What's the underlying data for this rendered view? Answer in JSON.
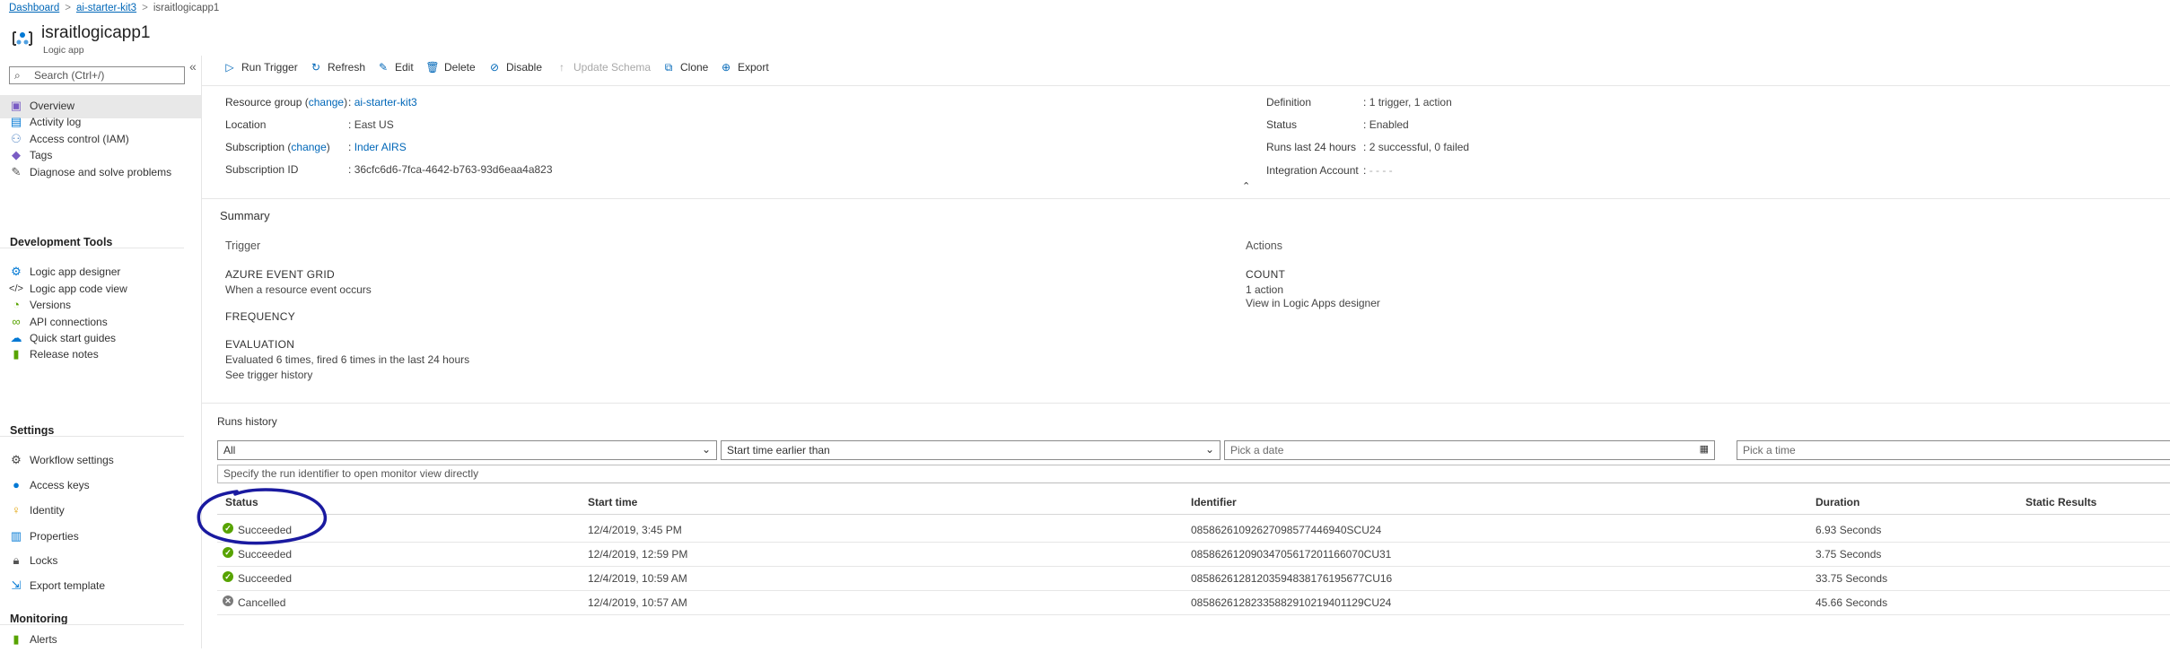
{
  "breadcrumb": [
    {
      "label": "Dashboard",
      "link": true
    },
    {
      "label": "ai-starter-kit3",
      "link": true
    },
    {
      "label": "israitlogicapp1",
      "link": false
    }
  ],
  "header": {
    "title": "israitlogicapp1",
    "subtitle": "Logic app"
  },
  "search": {
    "placeholder": "Search (Ctrl+/)"
  },
  "sidebar": {
    "collapse_glyph": "«",
    "items_top": [
      {
        "label": "Overview",
        "icon": "overview-icon"
      },
      {
        "label": "Activity log",
        "icon": "activity-log-icon"
      },
      {
        "label": "Access control (IAM)",
        "icon": "people-icon"
      },
      {
        "label": "Tags",
        "icon": "tag-icon"
      },
      {
        "label": "Diagnose and solve problems",
        "icon": "wrench-icon"
      }
    ],
    "section_dev": "Development Tools",
    "items_dev": [
      {
        "label": "Logic app designer",
        "icon": "designer-icon"
      },
      {
        "label": "Logic app code view",
        "icon": "code-icon"
      },
      {
        "label": "Versions",
        "icon": "versions-icon"
      },
      {
        "label": "API connections",
        "icon": "link-icon"
      },
      {
        "label": "Quick start guides",
        "icon": "cloud-icon"
      },
      {
        "label": "Release notes",
        "icon": "bookmark-icon"
      }
    ],
    "section_settings": "Settings",
    "items_settings": [
      {
        "label": "Workflow settings",
        "icon": "gear-icon"
      },
      {
        "label": "Access keys",
        "icon": "key-icon"
      },
      {
        "label": "Identity",
        "icon": "identity-icon"
      },
      {
        "label": "Properties",
        "icon": "properties-icon"
      },
      {
        "label": "Locks",
        "icon": "lock-icon"
      },
      {
        "label": "Export template",
        "icon": "export-template-icon"
      }
    ],
    "section_monitoring": "Monitoring",
    "items_monitoring": [
      {
        "label": "Alerts",
        "icon": "alerts-icon"
      }
    ]
  },
  "toolbar": {
    "run_trigger": "Run Trigger",
    "refresh": "Refresh",
    "edit": "Edit",
    "delete": "Delete",
    "disable": "Disable",
    "update_schema": "Update Schema",
    "clone": "Clone",
    "export": "Export"
  },
  "essentials": {
    "resource_group_label": "Resource group",
    "change": "change",
    "resource_group_value": "ai-starter-kit3",
    "location_label": "Location",
    "location_value": "East US",
    "subscription_label": "Subscription",
    "subscription_value": "Inder AIRS",
    "subscription_id_label": "Subscription ID",
    "subscription_id_value": "36cfc6d6-7fca-4642-b763-93d6eaa4a823",
    "definition_label": "Definition",
    "definition_value": "1 trigger, 1 action",
    "status_label": "Status",
    "status_value": "Enabled",
    "runs_label": "Runs last 24 hours",
    "runs_value": "2 successful, 0 failed",
    "integration_label": "Integration Account",
    "integration_value": "- - - -",
    "collapse_glyph": "⌃"
  },
  "summary": {
    "title": "Summary",
    "trigger_title": "Trigger",
    "trigger_name": "AZURE EVENT GRID",
    "trigger_desc": "When a resource event occurs",
    "frequency_title": "FREQUENCY",
    "evaluation_title": "EVALUATION",
    "evaluation_desc": "Evaluated 6 times, fired 6 times in the last 24 hours",
    "trigger_history_link": "See trigger history",
    "actions_title": "Actions",
    "actions_count_label": "COUNT",
    "actions_count": "1 action",
    "designer_link": "View in Logic Apps designer"
  },
  "runs": {
    "title": "Runs history",
    "filter_status": "All",
    "filter_time": "Start time earlier than",
    "date_placeholder": "Pick a date",
    "time_placeholder": "Pick a time",
    "identifier_placeholder": "Specify the run identifier to open monitor view directly",
    "columns": {
      "status": "Status",
      "start": "Start time",
      "identifier": "Identifier",
      "duration": "Duration",
      "static": "Static Results"
    },
    "rows": [
      {
        "status": "Succeeded",
        "kind": "ok",
        "start": "12/4/2019, 3:45 PM",
        "identifier": "08586261092627098577446940SCU24",
        "duration": "6.93 Seconds"
      },
      {
        "status": "Succeeded",
        "kind": "ok",
        "start": "12/4/2019, 12:59 PM",
        "identifier": "08586261209034705617201166070CU31",
        "duration": "3.75 Seconds"
      },
      {
        "status": "Succeeded",
        "kind": "ok",
        "start": "12/4/2019, 10:59 AM",
        "identifier": "08586261281203594838176195677CU16",
        "duration": "33.75 Seconds"
      },
      {
        "status": "Cancelled",
        "kind": "cancel",
        "start": "12/4/2019, 10:57 AM",
        "identifier": "08586261282335882910219401129CU24",
        "duration": "45.66 Seconds"
      }
    ]
  },
  "colors": {
    "accent": "#0067b8",
    "success": "#57a300",
    "annotation": "#1a1aa0"
  }
}
